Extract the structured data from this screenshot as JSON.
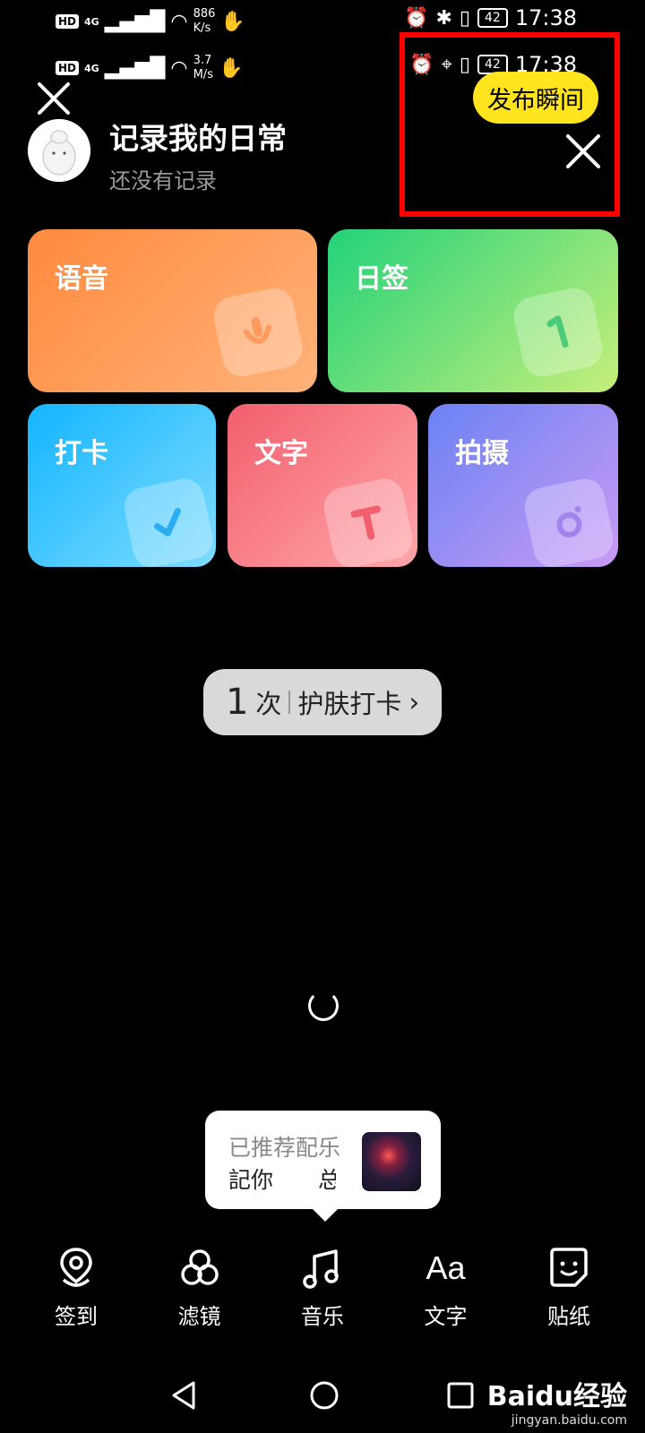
{
  "status_bar_top": {
    "hd": "HD",
    "signal": "4G",
    "speed_value": "886",
    "speed_unit": "K/s",
    "battery": "42",
    "time": "17:38"
  },
  "status_bar_second": {
    "hd": "HD",
    "signal": "4G",
    "speed_value": "3.7",
    "speed_unit": "M/s",
    "battery": "42",
    "time": "17:38"
  },
  "header": {
    "title": "记录我的日常",
    "subtitle": "还没有记录"
  },
  "publish_button": "发布瞬间",
  "cards": [
    {
      "label": "语音",
      "icon": "microphone-icon"
    },
    {
      "label": "日签",
      "icon": "day-number-icon"
    },
    {
      "label": "打卡",
      "icon": "checkmark-icon"
    },
    {
      "label": "文字",
      "icon": "letter-t-icon"
    },
    {
      "label": "拍摄",
      "icon": "camera-icon"
    }
  ],
  "checkin_pill": {
    "count": "1",
    "unit": "次",
    "label": "护肤打卡"
  },
  "music_tooltip": {
    "title": "已推荐配乐",
    "song": "記你　　总:"
  },
  "tools": [
    {
      "label": "签到",
      "icon": "location-pin-icon"
    },
    {
      "label": "滤镜",
      "icon": "filter-circles-icon"
    },
    {
      "label": "音乐",
      "icon": "music-note-icon"
    },
    {
      "label": "文字",
      "icon": "text-aa-icon",
      "glyph": "Aa"
    },
    {
      "label": "贴纸",
      "icon": "sticker-icon"
    }
  ],
  "watermark": {
    "main": "Baidu经验",
    "sub": "jingyan.baidu.com"
  }
}
